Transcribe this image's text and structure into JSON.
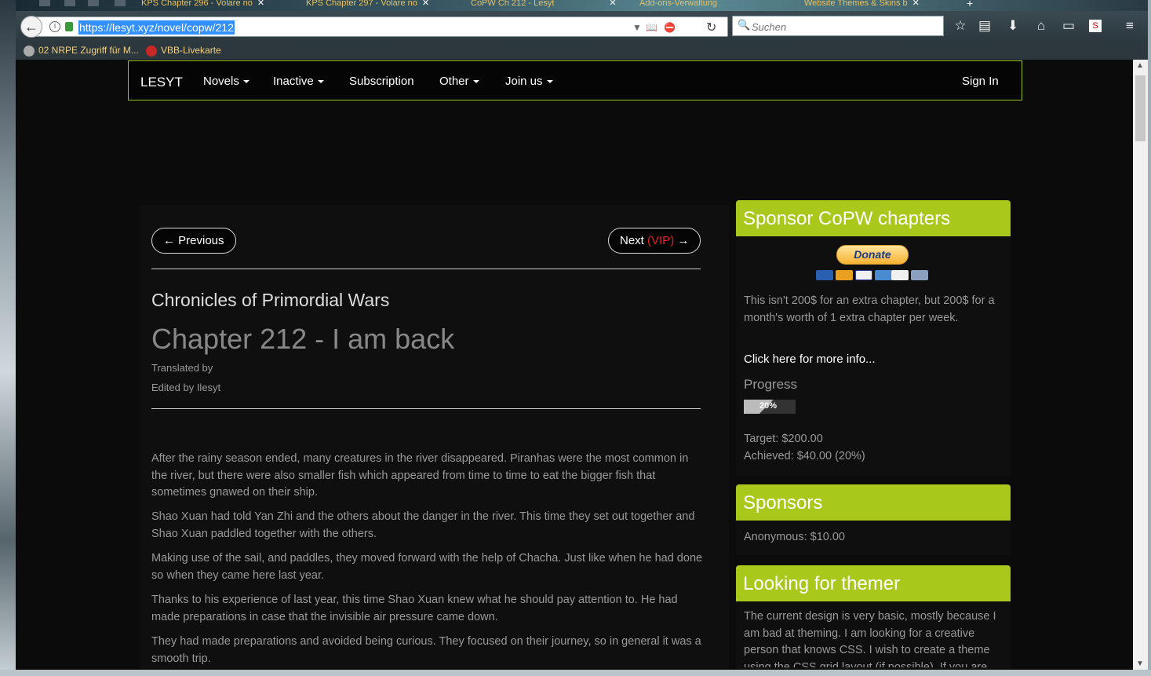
{
  "browser": {
    "tabs": [
      {
        "label": "KPS Chapter 296 - Volare no"
      },
      {
        "label": "KPS Chapter 297 - Volare no"
      },
      {
        "label": "CoPW Ch 212 - Lesyt"
      },
      {
        "label": "Add-ons-Verwaltung"
      },
      {
        "label": "Website Themes & Skins b"
      }
    ],
    "url": "https://lesyt.xyz/novel/copw/212",
    "search_placeholder": "Suchen",
    "bookmarks": [
      {
        "label": "02 NRPE Zugriff für M..."
      },
      {
        "label": "VBB-Livekarte"
      }
    ]
  },
  "site_nav": {
    "brand": "LESYT",
    "items": [
      "Novels",
      "Inactive",
      "Subscription",
      "Other",
      "Join us"
    ],
    "sign_in": "Sign In"
  },
  "chapter": {
    "prev_label": "← Previous",
    "next_label": "Next",
    "next_badge": "(VIP)",
    "next_arrow": "→",
    "series_title": "Chronicles of Primordial Wars",
    "title": "Chapter 212 - I am back",
    "translated_by": "Translated by",
    "edited_by": "Edited by Ilesyt",
    "paragraphs": [
      "After the rainy season ended, many creatures in the river disappeared. Piranhas were the most common in the river, but there were also smaller fish which appeared from time to time to eat the bigger fish that sometimes gnawed on their ship.",
      "Shao Xuan had told Yan Zhi and the others about the danger in the river. This time they set out together and Shao Xuan paddled together with the others.",
      "Making use of the sail, and paddles, they moved forward with the help of Chacha. Just like when he had done so when they came here last year.",
      "Thanks to his experience of last year, this time Shao Xuan knew what he should  pay attention to. He had made preparations in case that the invisible air pressure came down.",
      "They had made preparations and avoided being curious. They focused on their journey, so in general it was a smooth trip."
    ]
  },
  "sidebar": {
    "sponsor": {
      "title": "Sponsor CoPW chapters",
      "donate_label": "Donate",
      "cards": [
        "Maestro",
        "MasterCard",
        "VISA",
        "AmEx",
        "DISCOVER",
        "BANK"
      ],
      "description": "This isn't 200$ for an extra chapter, but 200$ for a month's worth of 1 extra chapter per week.",
      "more_info": "Click here for more info...",
      "progress_label": "Progress",
      "progress_percent": 20,
      "progress_text": "20%",
      "target": "Target: $200.00",
      "achieved": "Achieved: $40.00 (20%)"
    },
    "sponsors": {
      "title": "Sponsors",
      "entries": [
        "Anonymous: $10.00"
      ]
    },
    "themer": {
      "title": "Looking for themer",
      "text": "The current design is very basic, mostly because I am bad at theming. I am looking for a creative person that knows CSS. I wish to create a theme using the CSS grid layout (if possible). If you are"
    }
  },
  "colors": {
    "accent": "#a8c91c",
    "vip": "#e02020",
    "page_bg": "#0b0b0b",
    "selection": "#3390ff"
  }
}
